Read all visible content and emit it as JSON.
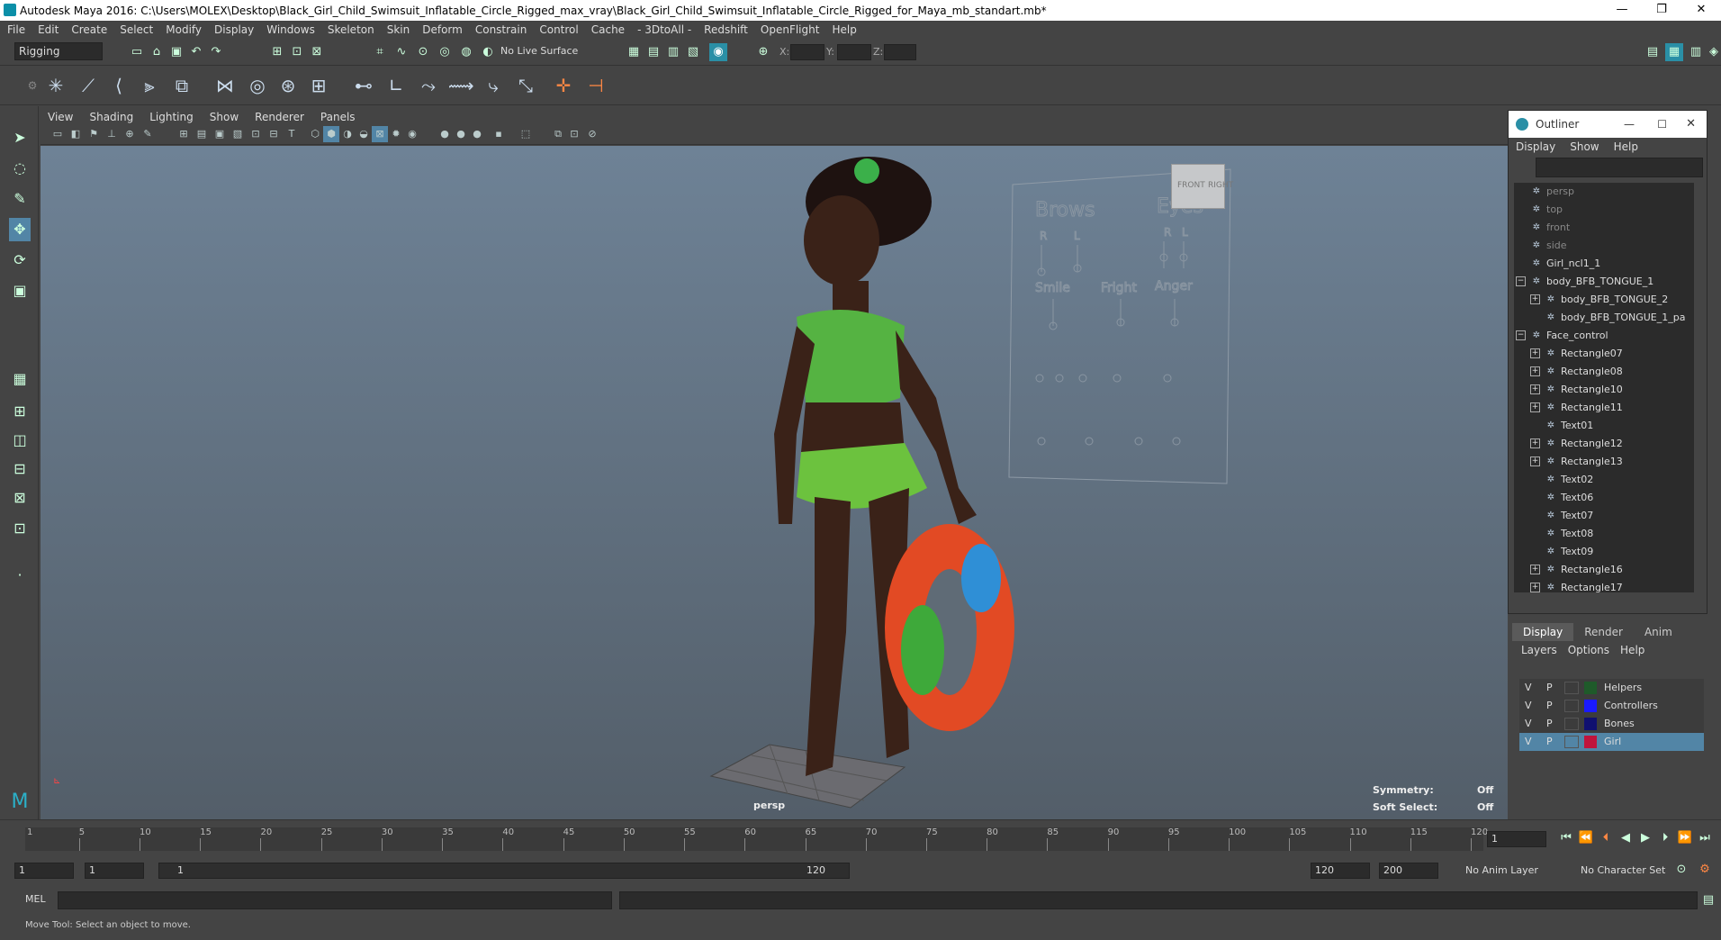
{
  "window": {
    "title": "Autodesk Maya 2016: C:\\Users\\MOLEX\\Desktop\\Black_Girl_Child_Swimsuit_Inflatable_Circle_Rigged_max_vray\\Black_Girl_Child_Swimsuit_Inflatable_Circle_Rigged_for_Maya_mb_standart.mb*",
    "minimize": "—",
    "maximize": "❐",
    "close": "✕"
  },
  "menu": [
    "File",
    "Edit",
    "Create",
    "Select",
    "Modify",
    "Display",
    "Windows",
    "Skeleton",
    "Skin",
    "Deform",
    "Constrain",
    "Control",
    "Cache",
    "- 3DtoAll -",
    "Redshift",
    "OpenFlight",
    "Help"
  ],
  "status": {
    "menuset": "Rigging",
    "live_surface": "No Live Surface",
    "x_label": "X:",
    "y_label": "Y:",
    "z_label": "Z:"
  },
  "viewport": {
    "menu": [
      "View",
      "Shading",
      "Lighting",
      "Show",
      "Renderer",
      "Panels"
    ],
    "camera": "persp",
    "symmetry_label": "Symmetry:",
    "symmetry_value": "Off",
    "soft_select_label": "Soft Select:",
    "soft_select_value": "Off",
    "viewcube_front": "FRONT",
    "viewcube_right": "RIGHT"
  },
  "face_panel": {
    "brows": "Brows",
    "eyes": "Eyes",
    "r": "R",
    "l": "L",
    "smile": "Smile",
    "fright": "Fright",
    "anger": "Anger"
  },
  "outliner": {
    "title": "Outliner",
    "menu": [
      "Display",
      "Show",
      "Help"
    ],
    "items": [
      {
        "label": "persp",
        "dim": true,
        "indent": 0,
        "exp": ""
      },
      {
        "label": "top",
        "dim": true,
        "indent": 0,
        "exp": ""
      },
      {
        "label": "front",
        "dim": true,
        "indent": 0,
        "exp": ""
      },
      {
        "label": "side",
        "dim": true,
        "indent": 0,
        "exp": ""
      },
      {
        "label": "Girl_ncl1_1",
        "dim": false,
        "indent": 0,
        "exp": ""
      },
      {
        "label": "body_BFB_TONGUE_1",
        "dim": false,
        "indent": 0,
        "exp": "−"
      },
      {
        "label": "body_BFB_TONGUE_2",
        "dim": false,
        "indent": 1,
        "exp": "+"
      },
      {
        "label": "body_BFB_TONGUE_1_pa",
        "dim": false,
        "indent": 1,
        "exp": ""
      },
      {
        "label": "Face_control",
        "dim": false,
        "indent": 0,
        "exp": "−"
      },
      {
        "label": "Rectangle07",
        "dim": false,
        "indent": 1,
        "exp": "+"
      },
      {
        "label": "Rectangle08",
        "dim": false,
        "indent": 1,
        "exp": "+"
      },
      {
        "label": "Rectangle10",
        "dim": false,
        "indent": 1,
        "exp": "+"
      },
      {
        "label": "Rectangle11",
        "dim": false,
        "indent": 1,
        "exp": "+"
      },
      {
        "label": "Text01",
        "dim": false,
        "indent": 1,
        "exp": ""
      },
      {
        "label": "Rectangle12",
        "dim": false,
        "indent": 1,
        "exp": "+"
      },
      {
        "label": "Rectangle13",
        "dim": false,
        "indent": 1,
        "exp": "+"
      },
      {
        "label": "Text02",
        "dim": false,
        "indent": 1,
        "exp": ""
      },
      {
        "label": "Text06",
        "dim": false,
        "indent": 1,
        "exp": ""
      },
      {
        "label": "Text07",
        "dim": false,
        "indent": 1,
        "exp": ""
      },
      {
        "label": "Text08",
        "dim": false,
        "indent": 1,
        "exp": ""
      },
      {
        "label": "Text09",
        "dim": false,
        "indent": 1,
        "exp": ""
      },
      {
        "label": "Rectangle16",
        "dim": false,
        "indent": 1,
        "exp": "+"
      },
      {
        "label": "Rectangle17",
        "dim": false,
        "indent": 1,
        "exp": "+"
      }
    ]
  },
  "layers": {
    "tabs": [
      "Display",
      "Render",
      "Anim"
    ],
    "menu": [
      "Layers",
      "Options",
      "Help"
    ],
    "rows": [
      {
        "v": "V",
        "p": "P",
        "name": "Helpers",
        "color": "#1f5a2a",
        "selected": false
      },
      {
        "v": "V",
        "p": "P",
        "name": "Controllers",
        "color": "#1a1aff",
        "selected": false
      },
      {
        "v": "V",
        "p": "P",
        "name": "Bones",
        "color": "#101070",
        "selected": false
      },
      {
        "v": "V",
        "p": "P",
        "name": "Girl",
        "color": "#c0143c",
        "selected": true
      }
    ]
  },
  "timeline": {
    "ticks": [
      "5",
      "10",
      "15",
      "20",
      "25",
      "30",
      "35",
      "40",
      "45",
      "50",
      "55",
      "60",
      "65",
      "70",
      "75",
      "80",
      "85",
      "90",
      "95",
      "100",
      "105",
      "110",
      "115",
      "120"
    ],
    "current_start": "1",
    "current_frame": "1"
  },
  "range": {
    "start": "1",
    "playback_start": "1",
    "slider_start": "1",
    "slider_end": "120",
    "playback_end": "120",
    "end": "200",
    "anim_layer": "No Anim Layer",
    "char_set": "No Character Set"
  },
  "cmd": {
    "label": "MEL"
  },
  "help": {
    "text": "Move Tool: Select an object to move."
  }
}
